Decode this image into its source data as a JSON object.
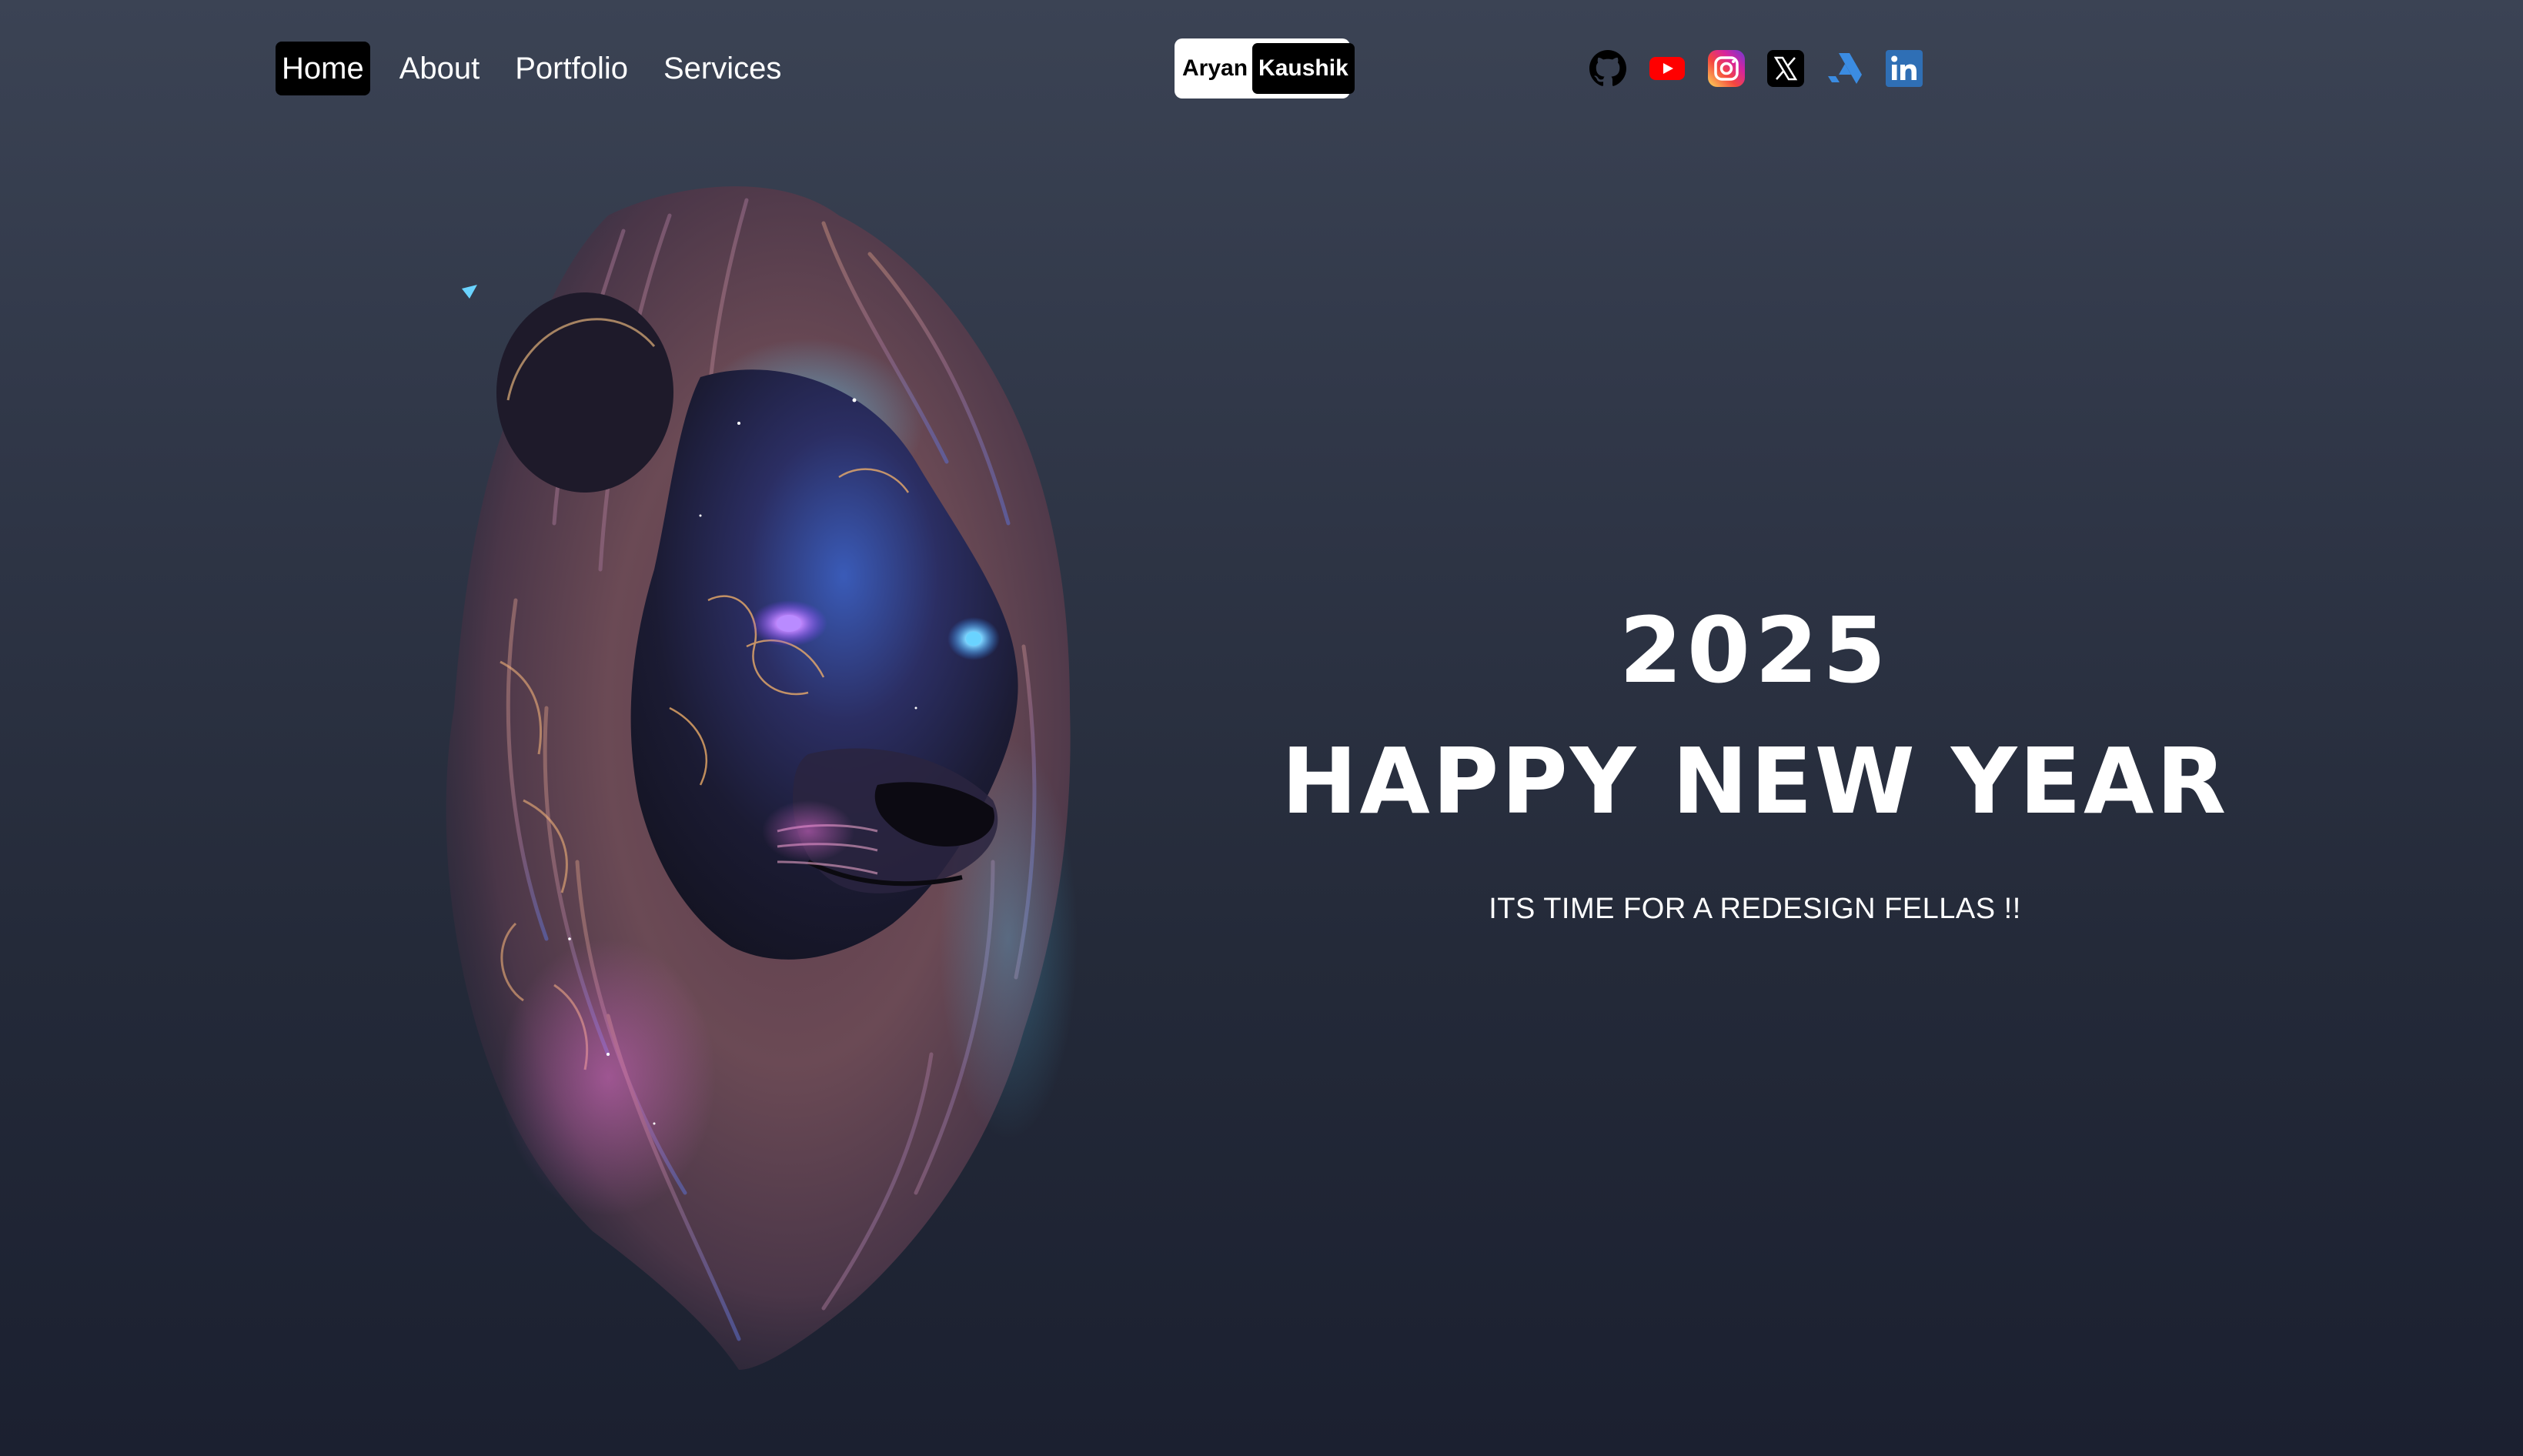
{
  "nav": {
    "items": [
      {
        "label": "Home",
        "active": true
      },
      {
        "label": "About",
        "active": false
      },
      {
        "label": "Portfolio",
        "active": false
      },
      {
        "label": "Services",
        "active": false
      }
    ]
  },
  "logo": {
    "first": "Aryan",
    "last": "Kaushik"
  },
  "socials": [
    {
      "icon": "github-icon",
      "color": "#000000"
    },
    {
      "icon": "youtube-icon",
      "color": "#ff0000"
    },
    {
      "icon": "instagram-icon",
      "color": "#d6249f"
    },
    {
      "icon": "x-twitter-icon",
      "color": "#000000"
    },
    {
      "icon": "artstation-icon",
      "color": "#3b8ce2"
    },
    {
      "icon": "linkedin-icon",
      "color": "#2f6fb5"
    }
  ],
  "hero": {
    "year": "2025",
    "headline": "HAPPY NEW YEAR",
    "tagline": "ITS TIME FOR A REDESIGN FELLAS !!",
    "image": "lion-cosmic-art"
  },
  "colors": {
    "accent": "#000000",
    "text": "#ffffff",
    "background_top": "#3b4354",
    "background_bottom": "#1b2030"
  }
}
